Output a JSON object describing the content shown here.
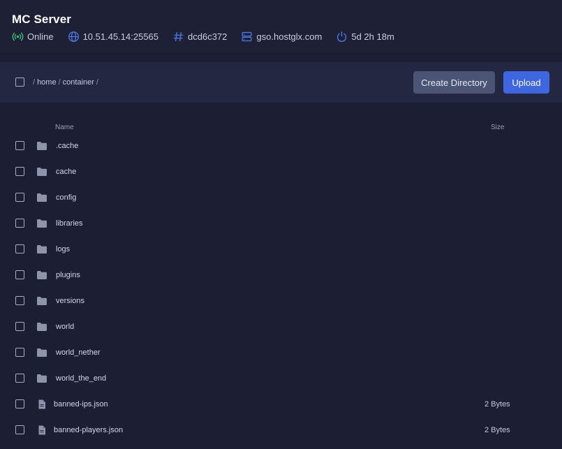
{
  "server": {
    "title": "MC Server",
    "status": "Online",
    "address": "10.51.45.14:25565",
    "id": "dcd6c372",
    "host": "gso.hostglx.com",
    "uptime": "5d 2h 18m",
    "status_color": "#3fbf6f",
    "accent_icon_color": "#4d79e8"
  },
  "toolbar": {
    "path": [
      "/",
      "home",
      "/",
      "container",
      "/"
    ],
    "create_directory_label": "Create Directory",
    "upload_label": "Upload"
  },
  "list": {
    "col_name": "Name",
    "col_size": "Size",
    "items": [
      {
        "type": "folder",
        "name": ".cache",
        "size": ""
      },
      {
        "type": "folder",
        "name": "cache",
        "size": ""
      },
      {
        "type": "folder",
        "name": "config",
        "size": ""
      },
      {
        "type": "folder",
        "name": "libraries",
        "size": ""
      },
      {
        "type": "folder",
        "name": "logs",
        "size": ""
      },
      {
        "type": "folder",
        "name": "plugins",
        "size": ""
      },
      {
        "type": "folder",
        "name": "versions",
        "size": ""
      },
      {
        "type": "folder",
        "name": "world",
        "size": ""
      },
      {
        "type": "folder",
        "name": "world_nether",
        "size": ""
      },
      {
        "type": "folder",
        "name": "world_the_end",
        "size": ""
      },
      {
        "type": "file",
        "name": "banned-ips.json",
        "size": "2 Bytes"
      },
      {
        "type": "file",
        "name": "banned-players.json",
        "size": "2 Bytes"
      }
    ]
  }
}
